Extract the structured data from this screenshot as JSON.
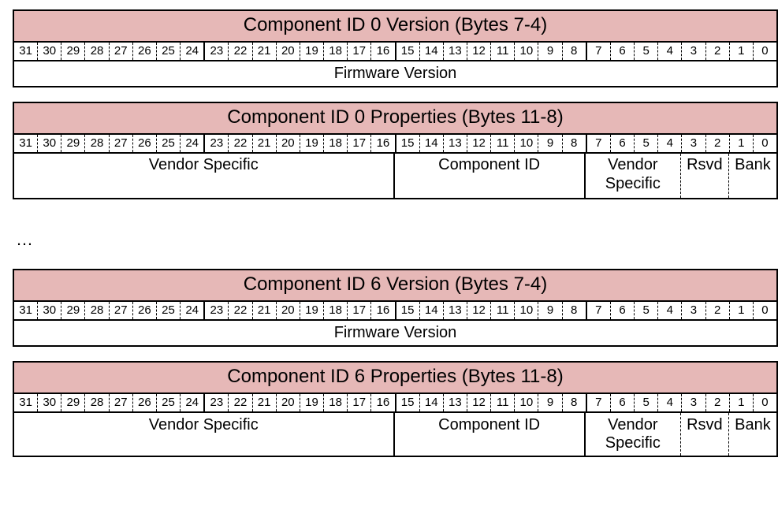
{
  "bits": [
    "31",
    "30",
    "29",
    "28",
    "27",
    "26",
    "25",
    "24",
    "23",
    "22",
    "21",
    "20",
    "19",
    "18",
    "17",
    "16",
    "15",
    "14",
    "13",
    "12",
    "11",
    "10",
    "9",
    "8",
    "7",
    "6",
    "5",
    "4",
    "3",
    "2",
    "1",
    "0"
  ],
  "labels": {
    "firmware_version": "Firmware Version",
    "vendor_specific": "Vendor Specific",
    "component_id": "Component ID",
    "vendor_specific_narrow": "Vendor\nSpecific",
    "rsvd": "Rsvd",
    "bank": "Bank"
  },
  "ellipsis": "…",
  "regs": [
    {
      "title": "Component ID 0 Version (Bytes 7-4)",
      "type": "version",
      "tall": false
    },
    {
      "title": "Component ID 0 Properties (Bytes 11-8)",
      "type": "properties",
      "tall": true
    },
    {
      "title": "Component ID 6 Version (Bytes 7-4)",
      "type": "version",
      "tall": false
    },
    {
      "title": "Component ID 6 Properties (Bytes 11-8)",
      "type": "properties",
      "tall": false
    }
  ]
}
